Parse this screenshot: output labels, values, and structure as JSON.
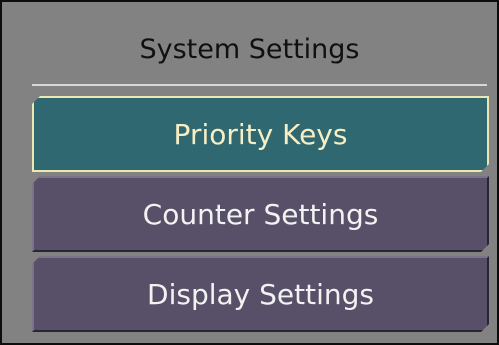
{
  "panel": {
    "title": "System Settings"
  },
  "menu": {
    "items": [
      {
        "label": "Priority Keys",
        "selected": true
      },
      {
        "label": "Counter Settings",
        "selected": false
      },
      {
        "label": "Display Settings",
        "selected": false
      }
    ]
  },
  "colors": {
    "panel_background": "#828282",
    "selected_item": "#2f6870",
    "selected_text": "#f6eec4",
    "item_background": "#585068",
    "item_text": "#f2f2f2"
  }
}
